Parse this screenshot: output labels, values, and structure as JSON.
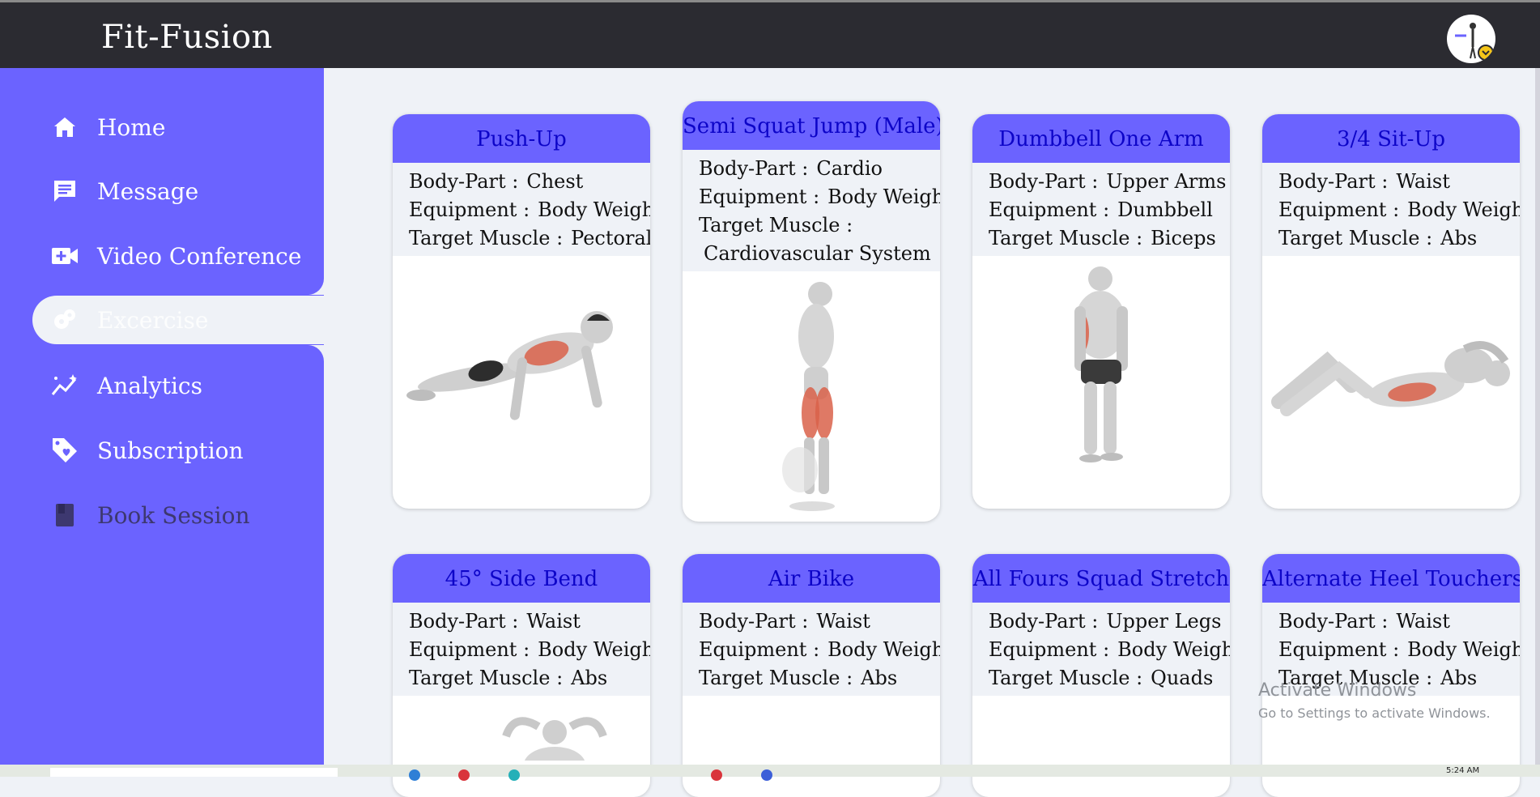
{
  "app": {
    "title": "Fit-Fusion"
  },
  "sidebar": {
    "items": [
      {
        "label": "Home",
        "icon": "home-icon"
      },
      {
        "label": "Message",
        "icon": "message-icon"
      },
      {
        "label": "Video Conference",
        "icon": "video-icon"
      },
      {
        "label": "Excercise",
        "icon": "exercise-icon",
        "active": true
      },
      {
        "label": "Analytics",
        "icon": "analytics-icon"
      },
      {
        "label": "Subscription",
        "icon": "tag-icon"
      },
      {
        "label": "Book Session",
        "icon": "book-icon"
      }
    ]
  },
  "labels": {
    "body_part": "Body-Part :",
    "equipment": "Equipment :",
    "target": "Target Muscle :"
  },
  "exercises": [
    {
      "name": "Push-Up",
      "body_part": "Chest",
      "equipment": "Body Weight",
      "target": "Pectorals"
    },
    {
      "name": "Semi Squat Jump (Male)",
      "body_part": "Cardio",
      "equipment": "Body Weight",
      "target": "Cardiovascular System"
    },
    {
      "name": "Dumbbell One Arm",
      "body_part": "Upper Arms",
      "equipment": "Dumbbell",
      "target": "Biceps"
    },
    {
      "name": "3/4 Sit-Up",
      "body_part": "Waist",
      "equipment": "Body Weight",
      "target": "Abs"
    },
    {
      "name": "45° Side Bend",
      "body_part": "Waist",
      "equipment": "Body Weight",
      "target": "Abs"
    },
    {
      "name": "Air Bike",
      "body_part": "Waist",
      "equipment": "Body Weight",
      "target": "Abs"
    },
    {
      "name": "All Fours Squad Stretch",
      "body_part": "Upper Legs",
      "equipment": "Body Weight",
      "target": "Quads"
    },
    {
      "name": "Alternate Heel Touchers",
      "body_part": "Waist",
      "equipment": "Body Weight",
      "target": "Abs"
    }
  ],
  "watermark": {
    "line1": "Activate Windows",
    "line2": "Go to Settings to activate Windows."
  },
  "taskbar": {
    "clock": "5:24 AM"
  },
  "colors": {
    "accent": "#6b63ff",
    "title_text": "#0d05c8",
    "topbar": "#2b2b31",
    "muscle": "#d9614a"
  }
}
